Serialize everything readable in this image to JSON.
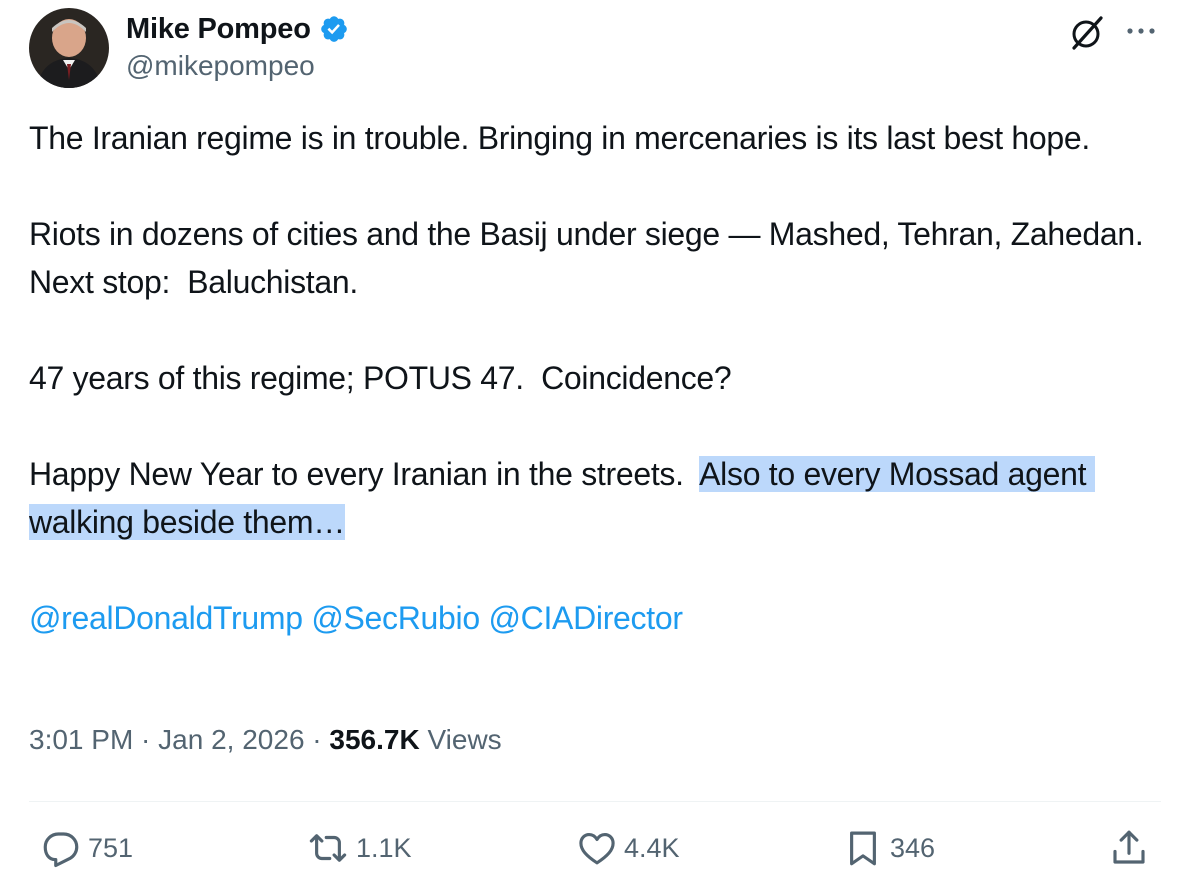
{
  "author": {
    "display_name": "Mike Pompeo",
    "handle": "@mikepompeo",
    "verified": true
  },
  "icons": {
    "verified": "verified-badge-icon",
    "grok": "grok-icon",
    "more": "more-options-icon",
    "reply": "reply-icon",
    "repost": "repost-icon",
    "like": "like-icon",
    "bookmark": "bookmark-icon",
    "share": "share-icon"
  },
  "tweet": {
    "paragraphs": [
      "The Iranian regime is in trouble. Bringing in mercenaries is its last best hope.",
      "Riots in dozens of cities and the Basij under siege — Mashed, Tehran, Zahedan.  Next stop:  Baluchistan.",
      "47 years of this regime; POTUS 47.  Coincidence?"
    ],
    "last_paragraph_plain": "Happy New Year to every Iranian in the streets.  ",
    "last_paragraph_highlighted": "Also to every Mossad agent walking beside them…",
    "mentions": [
      "@realDonaldTrump",
      "@SecRubio",
      "@CIADirector"
    ]
  },
  "meta": {
    "time": "3:01 PM",
    "separator": " · ",
    "date": "Jan 2, 2026",
    "views_count": "356.7K",
    "views_label": " Views"
  },
  "actions": {
    "replies": "751",
    "reposts": "1.1K",
    "likes": "4.4K",
    "bookmarks": "346"
  },
  "colors": {
    "accent": "#1d9bf0",
    "text": "#0f1419",
    "secondary": "#536471",
    "highlight": "#bcd8fb"
  }
}
